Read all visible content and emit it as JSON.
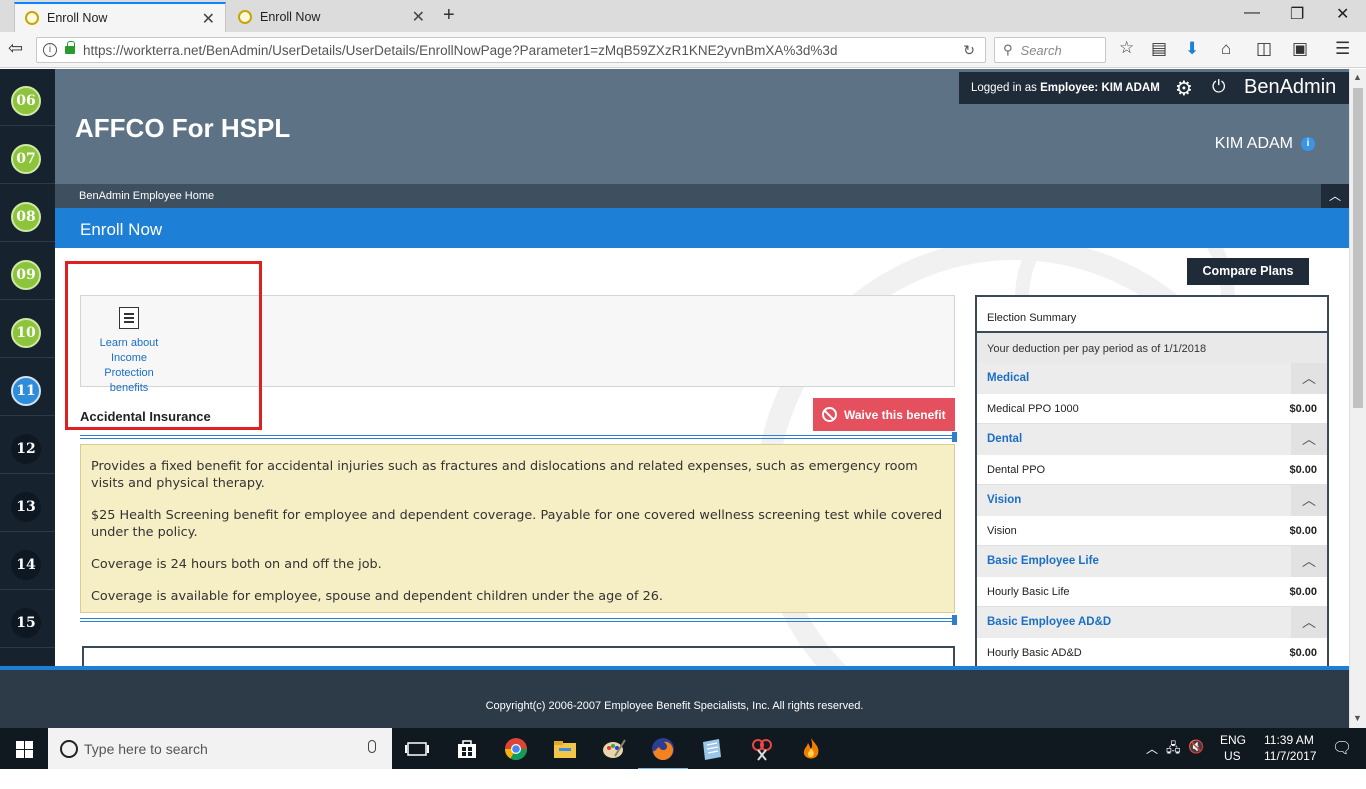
{
  "browser": {
    "tabs": [
      {
        "title": "Enroll Now",
        "active": true
      },
      {
        "title": "Enroll Now",
        "active": false
      }
    ],
    "url": "https://workterra.net/BenAdmin/UserDetails/UserDetails/EnrollNowPage?Parameter1=zMqB59ZXzR1KNE2yvnBmXA%3d%3d",
    "search_placeholder": "Search"
  },
  "steps": [
    {
      "num": "06",
      "state": "done"
    },
    {
      "num": "07",
      "state": "done"
    },
    {
      "num": "08",
      "state": "done"
    },
    {
      "num": "09",
      "state": "done"
    },
    {
      "num": "10",
      "state": "done"
    },
    {
      "num": "11",
      "state": "current"
    },
    {
      "num": "12",
      "state": "todo"
    },
    {
      "num": "13",
      "state": "todo"
    },
    {
      "num": "14",
      "state": "todo"
    },
    {
      "num": "15",
      "state": "todo"
    }
  ],
  "header": {
    "company": "AFFCO For HSPL",
    "logged_in_prefix": "Logged in as",
    "logged_in_role": "Employee:",
    "logged_in_user": "KIM ADAM",
    "brand": "BenAdmin",
    "user_name": "KIM ADAM",
    "breadcrumb": "BenAdmin Employee Home",
    "page_title": "Enroll Now"
  },
  "main": {
    "compare_plans": "Compare Plans",
    "learn_link": "Learn about Income Protection benefits",
    "benefit_name": "Accidental Insurance",
    "waive_label": "Waive this benefit",
    "description": [
      "Provides a fixed benefit for accidental injuries such as fractures and dislocations and related expenses, such as emergency room visits and physical therapy.",
      "$25 Health Screening benefit for employee and dependent coverage. Payable for one covered wellness screening test while covered under the policy.",
      "Coverage is 24 hours both on and off the job.",
      "Coverage is available for employee, spouse and dependent children under the age of 26."
    ]
  },
  "summary": {
    "title": "Election Summary",
    "subtitle": "Your deduction per pay period as of 1/1/2018",
    "categories": [
      {
        "name": "Medical",
        "plan": "Medical PPO 1000",
        "amount": "$0.00"
      },
      {
        "name": "Dental",
        "plan": "Dental PPO",
        "amount": "$0.00"
      },
      {
        "name": "Vision",
        "plan": "Vision",
        "amount": "$0.00"
      },
      {
        "name": "Basic Employee Life",
        "plan": "Hourly Basic Life",
        "amount": "$0.00"
      },
      {
        "name": "Basic Employee AD&D",
        "plan": "Hourly Basic AD&D",
        "amount": "$0.00"
      }
    ]
  },
  "footer": {
    "copyright": "Copyright(c) 2006-2007 Employee Benefit Specialists, Inc. All rights reserved."
  },
  "taskbar": {
    "search_placeholder": "Type here to search",
    "language": "ENG",
    "region": "US",
    "time": "11:39 AM",
    "date": "11/7/2017"
  },
  "colors": {
    "accent_blue": "#1e7fd6",
    "header_slate": "#5e7285",
    "waive_red": "#e4505e",
    "highlight_red": "#e02020",
    "step_done": "#8cc43c",
    "step_current": "#2f8cd8"
  }
}
